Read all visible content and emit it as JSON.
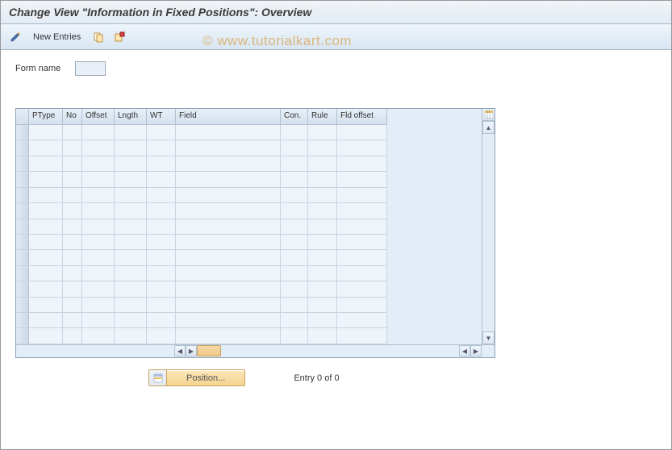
{
  "title": "Change View \"Information in Fixed Positions\": Overview",
  "toolbar": {
    "new_entries_label": "New Entries"
  },
  "watermark": "©  www.tutorialkart.com",
  "form": {
    "name_label": "Form name",
    "name_value": ""
  },
  "table": {
    "columns": [
      {
        "label": "PType",
        "width": 42
      },
      {
        "label": "No",
        "width": 24
      },
      {
        "label": "Offset",
        "width": 40
      },
      {
        "label": "Lngth",
        "width": 40
      },
      {
        "label": "WT",
        "width": 36
      },
      {
        "label": "Field",
        "width": 130
      },
      {
        "label": "Con.",
        "width": 34
      },
      {
        "label": "Rule",
        "width": 36
      },
      {
        "label": "Fld offset",
        "width": 62
      }
    ],
    "row_count": 14
  },
  "footer": {
    "position_label": "Position...",
    "entry_text": "Entry 0 of 0"
  }
}
